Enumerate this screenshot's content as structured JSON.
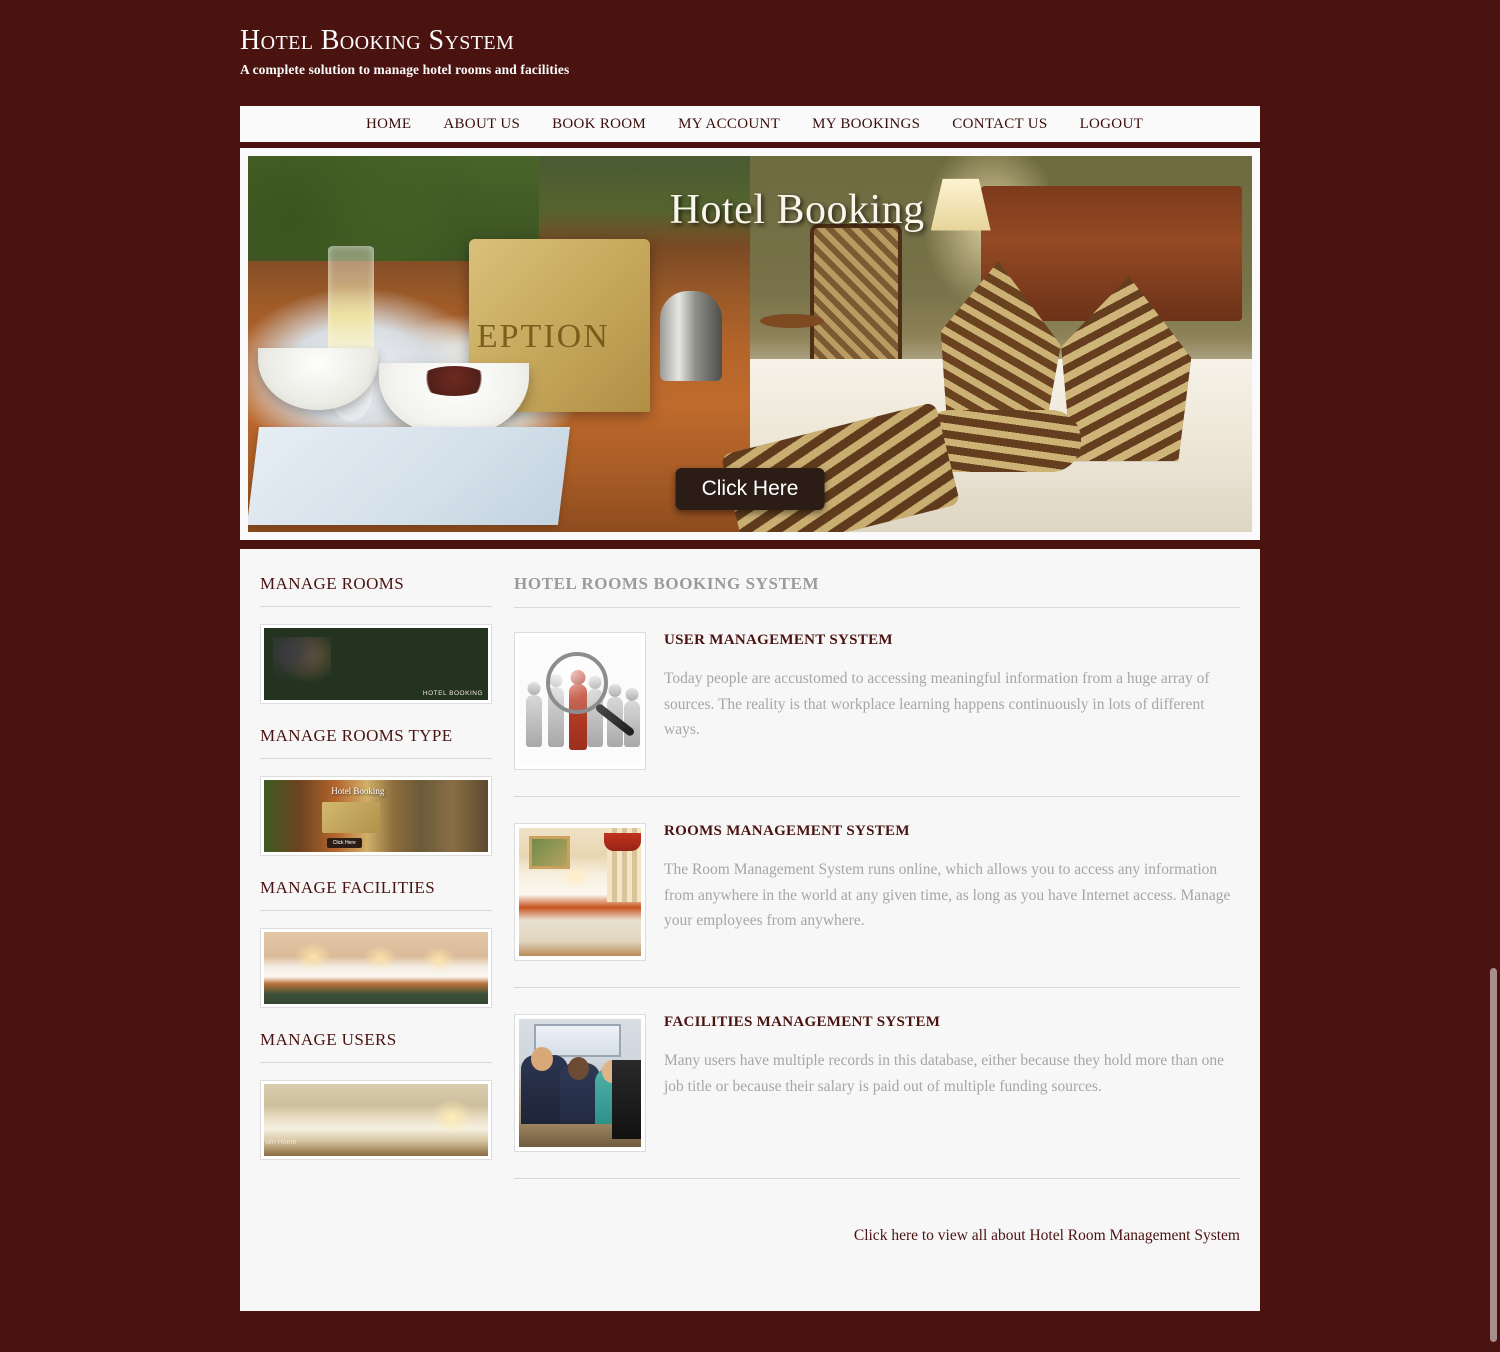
{
  "header": {
    "title": "Hotel Booking System",
    "tagline": "A complete solution to manage hotel rooms and facilities"
  },
  "nav": {
    "items": [
      {
        "label": "HOME"
      },
      {
        "label": "ABOUT US"
      },
      {
        "label": "BOOK ROOM"
      },
      {
        "label": "MY ACCOUNT"
      },
      {
        "label": "MY BOOKINGS"
      },
      {
        "label": "CONTACT US"
      },
      {
        "label": "LOGOUT"
      }
    ]
  },
  "banner": {
    "headline": "Hotel Booking",
    "sign_text": "EPTION",
    "cta_label": "Click Here"
  },
  "sidebar": {
    "sections": [
      {
        "heading": "MANAGE ROOMS",
        "thumb_caption": "HOTEL BOOKING"
      },
      {
        "heading": "MANAGE ROOMS TYPE",
        "thumb_caption": "Hotel Booking",
        "thumb_cta": "Click Here"
      },
      {
        "heading": "MANAGE FACILITIES",
        "thumb_caption": ""
      },
      {
        "heading": "MANAGE USERS",
        "thumb_caption": "om Home"
      }
    ]
  },
  "main": {
    "heading": "HOTEL ROOMS BOOKING SYSTEM",
    "features": [
      {
        "title": "USER MANAGEMENT SYSTEM",
        "text": "Today people are accustomed to accessing meaningful information from a huge array of sources. The reality is that workplace learning happens continuously in lots of different ways."
      },
      {
        "title": "ROOMS MANAGEMENT SYSTEM",
        "text": "The Room Management System runs online, which allows you to access any information from anywhere in the world at any given time, as long as you have Internet access. Manage your employees from anywhere."
      },
      {
        "title": "FACILITIES MANAGEMENT SYSTEM",
        "text": "Many users have multiple records in this database, either because they hold more than one job title or because their salary is paid out of multiple funding sources."
      }
    ],
    "footer_link": "Click here to view all about Hotel Room Management System"
  },
  "colors": {
    "page_background": "#4a1310",
    "panel_background": "#f7f7f7",
    "accent": "#4a1310",
    "muted_text": "#a6a6a6",
    "divider": "#d8d8d8",
    "scrollbar_thumb": "#a98e8e"
  }
}
